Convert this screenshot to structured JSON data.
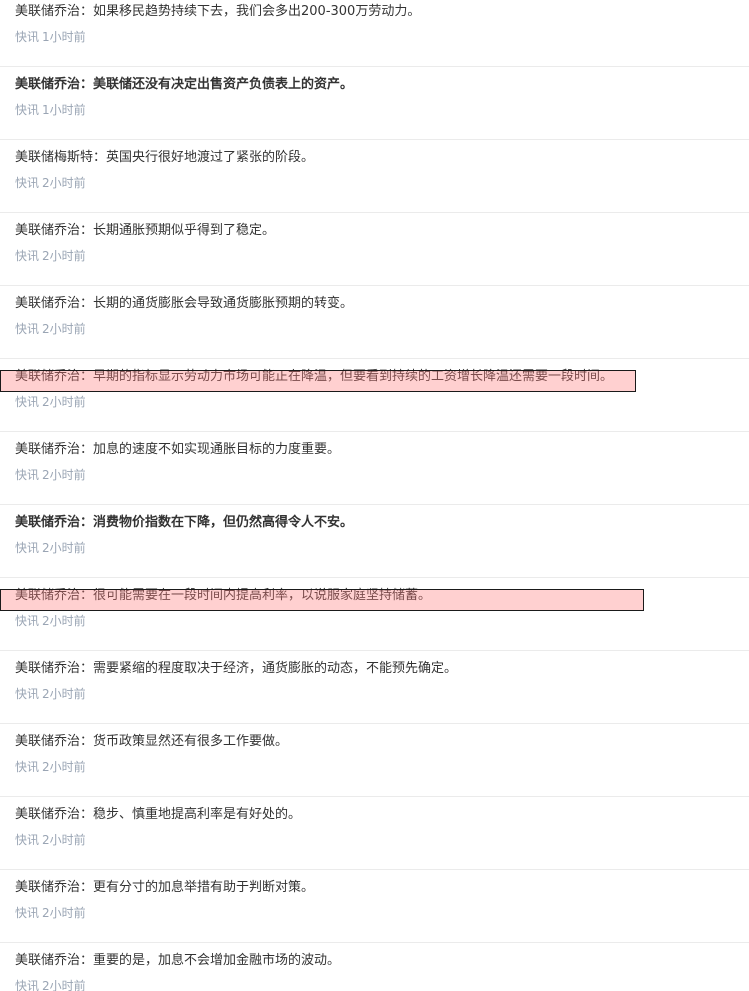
{
  "news_feed": {
    "items": [
      {
        "text": "美联储乔治：如果移民趋势持续下去，我们会多出200-300万劳动力。",
        "bold": false,
        "tag": "快讯",
        "time": "1小时前"
      },
      {
        "text": "美联储乔治：美联储还没有决定出售资产负债表上的资产。",
        "bold": true,
        "tag": "快讯",
        "time": "1小时前"
      },
      {
        "text": "美联储梅斯特：英国央行很好地渡过了紧张的阶段。",
        "bold": false,
        "tag": "快讯",
        "time": "2小时前"
      },
      {
        "text": "美联储乔治：长期通胀预期似乎得到了稳定。",
        "bold": false,
        "tag": "快讯",
        "time": "2小时前"
      },
      {
        "text": "美联储乔治：长期的通货膨胀会导致通货膨胀预期的转变。",
        "bold": false,
        "tag": "快讯",
        "time": "2小时前"
      },
      {
        "text": "美联储乔治：早期的指标显示劳动力市场可能正在降温，但要看到持续的工资增长降温还需要一段时间。",
        "bold": false,
        "tag": "快讯",
        "time": "2小时前"
      },
      {
        "text": "美联储乔治：加息的速度不如实现通胀目标的力度重要。",
        "bold": false,
        "tag": "快讯",
        "time": "2小时前"
      },
      {
        "text": "美联储乔治：消费物价指数在下降，但仍然高得令人不安。",
        "bold": true,
        "tag": "快讯",
        "time": "2小时前"
      },
      {
        "text": "美联储乔治：很可能需要在一段时间内提高利率，以说服家庭坚持储蓄。",
        "bold": false,
        "tag": "快讯",
        "time": "2小时前"
      },
      {
        "text": "美联储乔治：需要紧缩的程度取决于经济，通货膨胀的动态，不能预先确定。",
        "bold": false,
        "tag": "快讯",
        "time": "2小时前"
      },
      {
        "text": "美联储乔治：货币政策显然还有很多工作要做。",
        "bold": false,
        "tag": "快讯",
        "time": "2小时前"
      },
      {
        "text": "美联储乔治：稳步、慎重地提高利率是有好处的。",
        "bold": false,
        "tag": "快讯",
        "time": "2小时前"
      },
      {
        "text": "美联储乔治：更有分寸的加息举措有助于判断对策。",
        "bold": false,
        "tag": "快讯",
        "time": "2小时前"
      },
      {
        "text": "美联储乔治：重要的是，加息不会增加金融市场的波动。",
        "bold": false,
        "tag": "快讯",
        "time": "2小时前"
      }
    ]
  },
  "colors": {
    "headline": "#333333",
    "meta": "#9aa5b4",
    "divider": "#ebebeb",
    "highlight_fill": "#ff7878",
    "highlight_border": "#1a1a1a"
  }
}
